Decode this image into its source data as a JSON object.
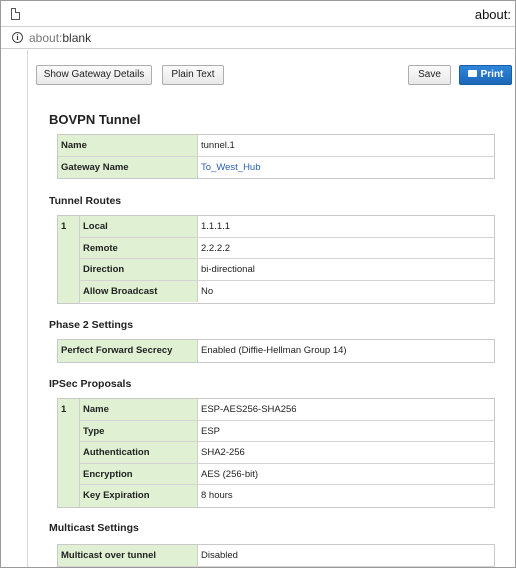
{
  "browser": {
    "title": "about:",
    "url_prefix": "about:",
    "url_rest": "blank"
  },
  "toolbar": {
    "show_gateway_label": "Show Gateway Details",
    "plain_text_label": "Plain Text",
    "save_label": "Save",
    "print_label": "Print"
  },
  "heading": "BOVPN Tunnel",
  "tunnel": {
    "name_key": "Name",
    "name_value": "tunnel.1",
    "gateway_key": "Gateway Name",
    "gateway_value": "To_West_Hub"
  },
  "routes": {
    "heading": "Tunnel Routes",
    "index": "1",
    "rows": [
      {
        "key": "Local",
        "value": "1.1.1.1"
      },
      {
        "key": "Remote",
        "value": "2.2.2.2"
      },
      {
        "key": "Direction",
        "value": "bi-directional"
      },
      {
        "key": "Allow Broadcast",
        "value": "No"
      }
    ]
  },
  "phase2": {
    "heading": "Phase 2 Settings",
    "pfs_key": "Perfect Forward Secrecy",
    "pfs_value": "Enabled (Diffie-Hellman Group 14)"
  },
  "ipsec": {
    "heading": "IPSec Proposals",
    "index": "1",
    "rows": [
      {
        "key": "Name",
        "value": "ESP-AES256-SHA256"
      },
      {
        "key": "Type",
        "value": "ESP"
      },
      {
        "key": "Authentication",
        "value": "SHA2-256"
      },
      {
        "key": "Encryption",
        "value": "AES (256-bit)"
      },
      {
        "key": "Key Expiration",
        "value": "8 hours"
      }
    ]
  },
  "multicast": {
    "heading": "Multicast Settings",
    "over_tunnel_key": "Multicast over tunnel",
    "over_tunnel_value": "Disabled"
  },
  "colors": {
    "key_bg": "#dff0d3",
    "link": "#2a5fb0",
    "print_button": "#1b66b9"
  }
}
